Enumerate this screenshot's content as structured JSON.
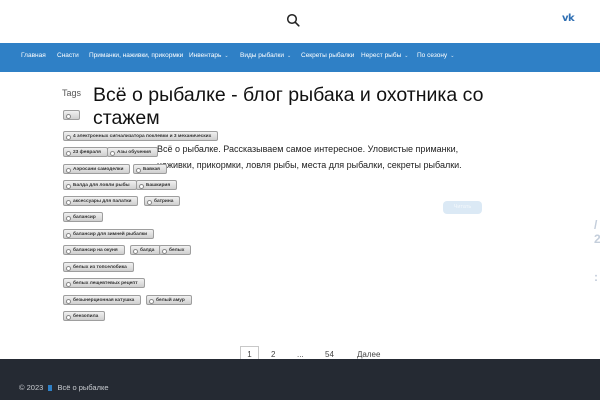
{
  "header": {
    "search_icon": "search-icon",
    "social_icon": "vk-icon",
    "social_label": "vk"
  },
  "nav": {
    "items": [
      {
        "label": "Главная",
        "has_dropdown": false
      },
      {
        "label": "Снасти",
        "has_dropdown": false
      },
      {
        "label": "Приманки, наживки, прикормки",
        "has_dropdown": false
      },
      {
        "label": "Инвентарь",
        "has_dropdown": true
      },
      {
        "label": "Виды рыбалки",
        "has_dropdown": true
      },
      {
        "label": "Секреты рыбалки",
        "has_dropdown": false
      },
      {
        "label": "Нерест рыбы",
        "has_dropdown": true
      },
      {
        "label": "По сезону",
        "has_dropdown": true
      }
    ],
    "caret": "⌄"
  },
  "tags_title": "Tags",
  "page_title": "Всё о рыбалке - блог рыбака и охотника со стажем",
  "page_description": "Всё о рыбалке. Рассказываем самое интересное. Уловистые приманки, наживки, прикормки, ловля рыбы, места для рыбалки, секреты рыбалки.",
  "faded_button": "Читать",
  "side_glyphs": [
    "/",
    "2",
    ":"
  ],
  "tags": [
    "",
    "4 электронных сигнализатора поклевки и 3 механических",
    "23 февраля",
    "Азы обучения",
    "Аэросани самоделки",
    "Бавкая",
    "Балда для ловли рыбы",
    "Башкирия",
    "аксессуары для палатки",
    "батрина",
    "балансир",
    "балансир для зимней рыбалки",
    "балансир на окуня",
    "балда",
    "белых",
    "белых из топселобика",
    "белых лещевтевых рецепт",
    "безынерционная катушка",
    "белый амур",
    "бензопила"
  ],
  "pagination": {
    "current": "1",
    "pages": [
      "2",
      "...",
      "54"
    ],
    "next": "Далее"
  },
  "footer": {
    "copyright": "© 2023",
    "site_name": "Всё о рыбалке"
  },
  "colors": {
    "nav_bg": "#2f80c6",
    "footer_bg": "#252a33",
    "vk": "#2f6fb3"
  }
}
